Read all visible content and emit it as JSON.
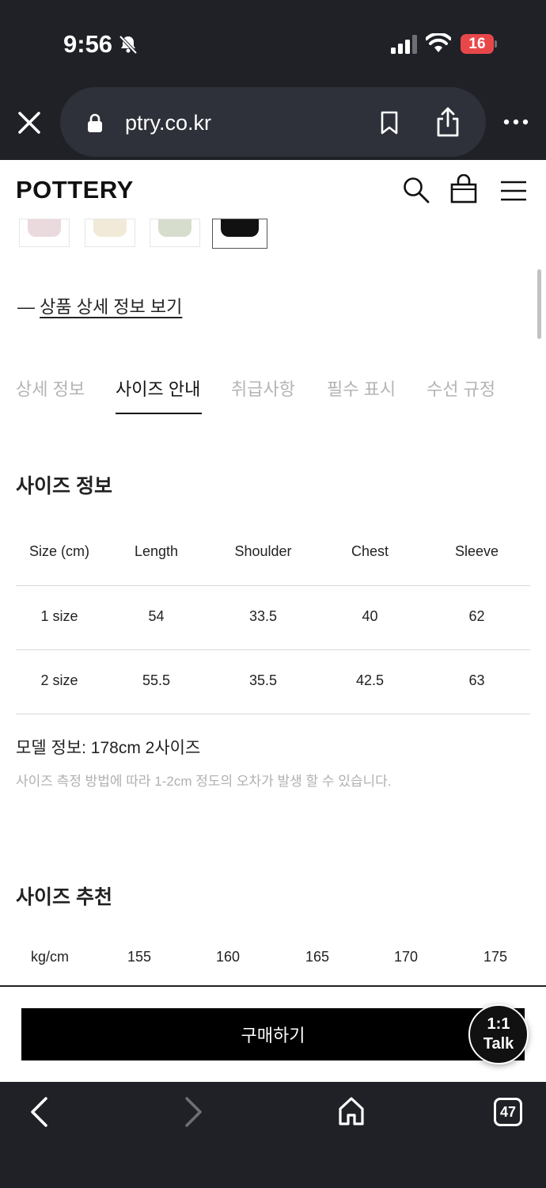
{
  "status_bar": {
    "time": "9:56",
    "battery": "16"
  },
  "browser": {
    "url": "ptry.co.kr",
    "tab_count": "47"
  },
  "site": {
    "logo": "POTTERY"
  },
  "thumbnails": [
    {
      "color": "#ead9dd"
    },
    {
      "color": "#f2ead9"
    },
    {
      "color": "#d7ddcd"
    },
    {
      "color": "#111111"
    }
  ],
  "detail_link": {
    "dash": "— ",
    "label": "상품 상세 정보 보기"
  },
  "tabs": [
    {
      "label": "상세 정보"
    },
    {
      "label": "사이즈 안내"
    },
    {
      "label": "취급사항"
    },
    {
      "label": "필수 표시"
    },
    {
      "label": "수선 규정"
    }
  ],
  "size_info": {
    "title": "사이즈 정보",
    "headers": [
      "Size (cm)",
      "Length",
      "Shoulder",
      "Chest",
      "Sleeve"
    ],
    "rows": [
      [
        "1 size",
        "54",
        "33.5",
        "40",
        "62"
      ],
      [
        "2 size",
        "55.5",
        "35.5",
        "42.5",
        "63"
      ]
    ],
    "model_info": "모델 정보: 178cm 2사이즈",
    "note": "사이즈 측정 방법에 따라 1-2cm 정도의 오차가 발생 할 수 있습니다."
  },
  "size_recommend": {
    "title": "사이즈 추천",
    "headers": [
      "kg/cm",
      "155",
      "160",
      "165",
      "170",
      "175"
    ]
  },
  "buy_button": "구매하기",
  "talk_button": {
    "line1": "1:1",
    "line2": "Talk"
  }
}
